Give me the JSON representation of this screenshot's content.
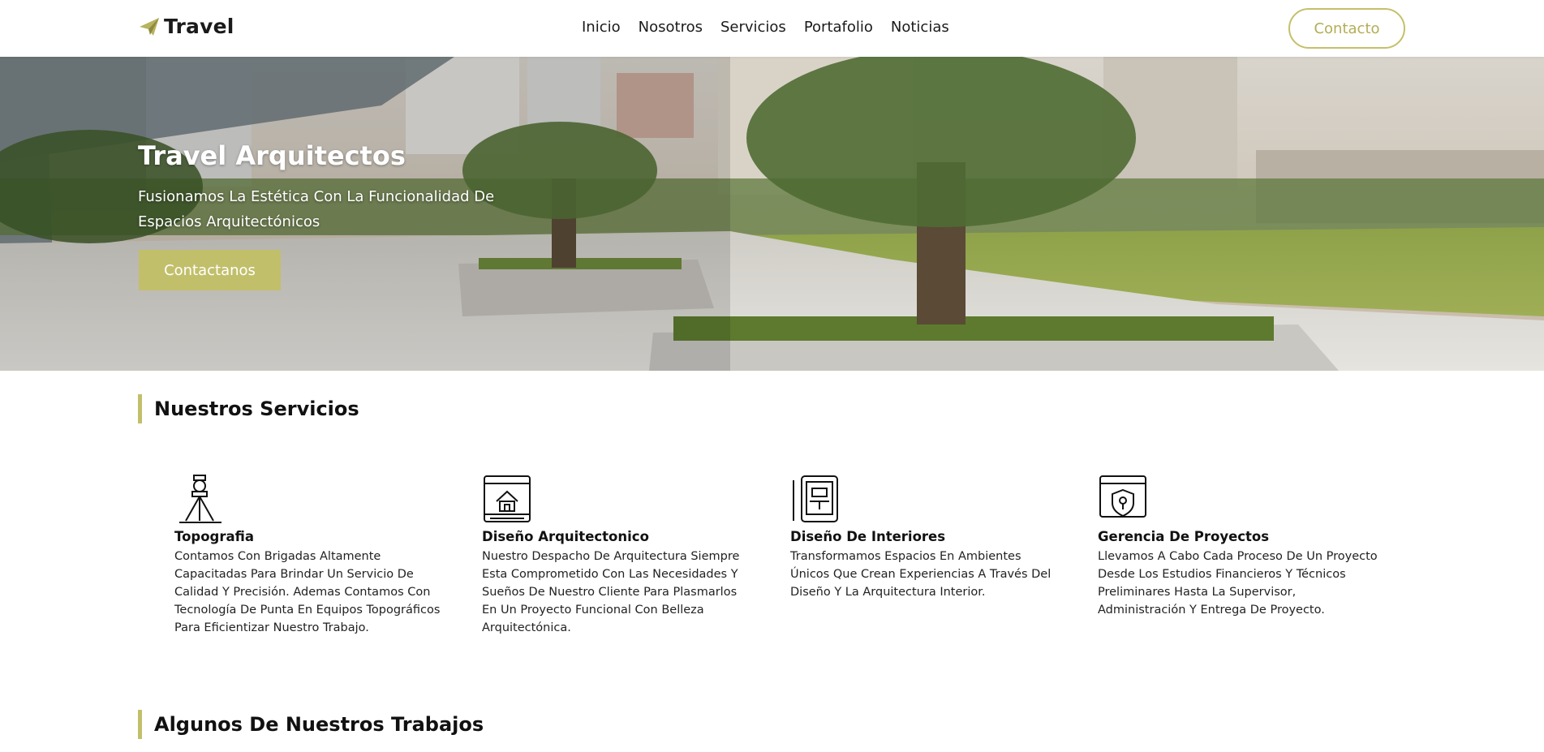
{
  "header": {
    "brand": "Travel",
    "brand_icon": "paper-plane-icon",
    "nav": [
      "Inicio",
      "Nosotros",
      "Servicios",
      "Portafolio",
      "Noticias"
    ],
    "contact_button": "Contacto",
    "accent": "#c2bf6b"
  },
  "hero": {
    "title": "Travel Arquitectos",
    "subtitle": "Fusionamos La Estética Con La Funcionalidad De Espacios Arquitectónicos",
    "cta": "Contactanos"
  },
  "services": {
    "title": "Nuestros Servicios",
    "items": [
      {
        "icon": "theodolite-icon",
        "name": "Topografia",
        "description": "Contamos Con Brigadas Altamente Capacitadas Para Brindar Un Servicio De Calidad Y Precisión. Ademas Contamos Con Tecnología De Punta En Equipos Topográficos Para Eficientizar Nuestro Trabajo."
      },
      {
        "icon": "blueprint-house-icon",
        "name": "Diseño Arquitectonico",
        "description": "Nuestro Despacho De Arquitectura Siempre Esta Comprometido Con Las Necesidades Y Sueños De Nuestro Cliente Para Plasmarlos En Un Proyecto Funcional Con Belleza Arquitectónica."
      },
      {
        "icon": "tablet-design-icon",
        "name": "Diseño De Interiores",
        "description": "Transformamos Espacios En Ambientes Únicos Que Crean Experiencias A Través Del Diseño Y La Arquitectura Interior."
      },
      {
        "icon": "shield-management-icon",
        "name": "Gerencia De Proyectos",
        "description": "Llevamos A Cabo Cada Proceso De Un Proyecto Desde Los Estudios Financieros Y Técnicos Preliminares Hasta La Supervisor, Administración Y Entrega De Proyecto."
      }
    ]
  },
  "works": {
    "title": "Algunos De Nuestros Trabajos"
  }
}
